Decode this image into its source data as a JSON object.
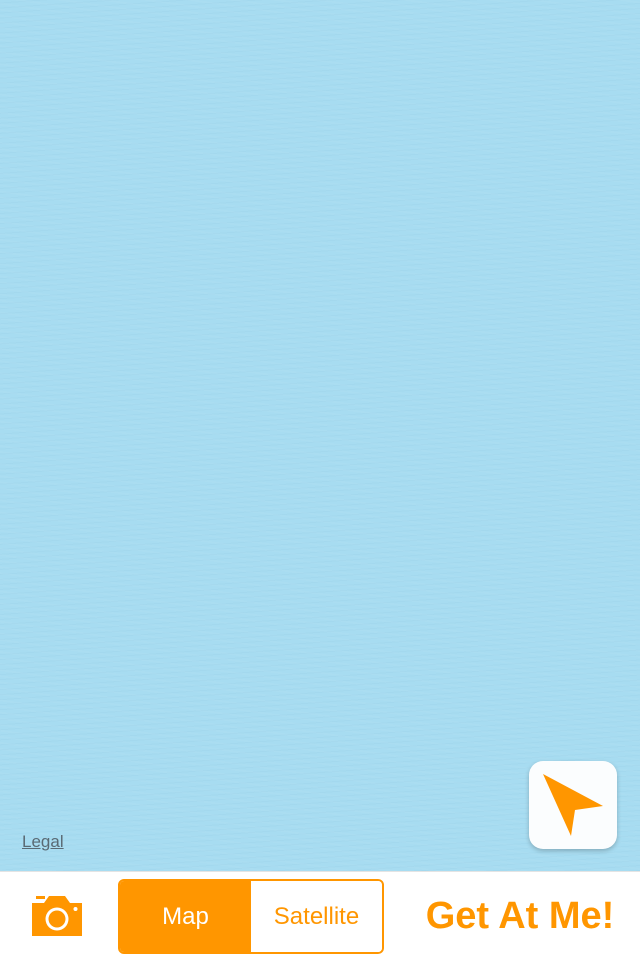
{
  "map": {
    "legal_label": "Legal",
    "water_color": "#a7dcf1"
  },
  "locate_button": {
    "icon": "location-arrow-icon"
  },
  "toolbar": {
    "camera_icon": "camera-icon",
    "segments": [
      {
        "label": "Map",
        "selected": true
      },
      {
        "label": "Satellite",
        "selected": false
      }
    ],
    "action_label": "Get At Me!",
    "accent_color": "#ff9600"
  }
}
